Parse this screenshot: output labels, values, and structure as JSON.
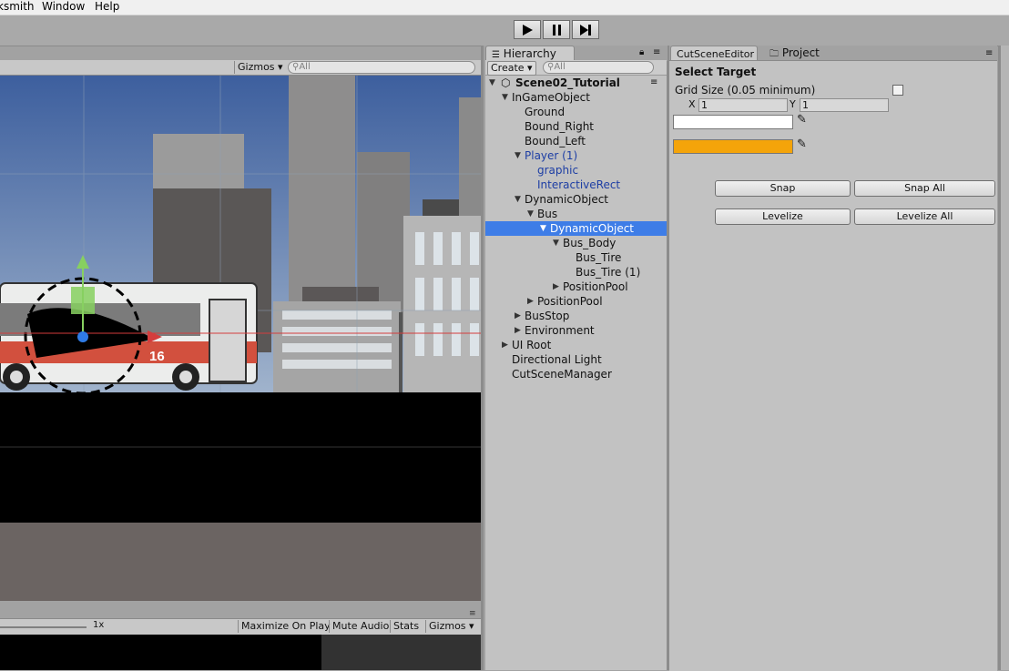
{
  "menu": {
    "items": [
      "ksmith",
      "Window",
      "Help"
    ]
  },
  "playbar": {
    "play_icon": "play-icon",
    "pause_icon": "pause-icon",
    "step_icon": "step-icon"
  },
  "scene": {
    "gizmos_label": "Gizmos",
    "search_placeholder": "All",
    "bus_number": "16"
  },
  "game": {
    "scale_label": "1x",
    "buttons": [
      "Maximize On Play",
      "Mute Audio",
      "Stats",
      "Gizmos"
    ]
  },
  "hierarchy": {
    "tab_label": "Hierarchy",
    "create_label": "Create",
    "search_placeholder": "All",
    "scene_name": "Scene02_Tutorial",
    "items": [
      {
        "label": "InGameObject",
        "arrow": "▼"
      },
      {
        "label": "Ground",
        "arrow": ""
      },
      {
        "label": "Bound_Right",
        "arrow": ""
      },
      {
        "label": "Bound_Left",
        "arrow": ""
      },
      {
        "label": "Player (1)",
        "arrow": "▼"
      },
      {
        "label": "graphic",
        "arrow": ""
      },
      {
        "label": "InteractiveRect",
        "arrow": ""
      },
      {
        "label": "DynamicObject",
        "arrow": "▼"
      },
      {
        "label": "Bus",
        "arrow": "▼"
      },
      {
        "label": "DynamicObject",
        "arrow": "▼"
      },
      {
        "label": "Bus_Body",
        "arrow": "▼"
      },
      {
        "label": "Bus_Tire",
        "arrow": ""
      },
      {
        "label": "Bus_Tire (1)",
        "arrow": ""
      },
      {
        "label": "PositionPool",
        "arrow": "▶"
      },
      {
        "label": "PositionPool",
        "arrow": "▶"
      },
      {
        "label": "BusStop",
        "arrow": "▶"
      },
      {
        "label": "Environment",
        "arrow": "▶"
      },
      {
        "label": "UI Root",
        "arrow": "▶"
      },
      {
        "label": "Directional Light",
        "arrow": ""
      },
      {
        "label": "CutSceneManager",
        "arrow": ""
      }
    ]
  },
  "cutscene": {
    "tab_label": "CutSceneEditor",
    "project_tab_label": "Project",
    "heading": "Select Target",
    "grid_size_label": "Grid Size (0.05 minimum)",
    "x_label": "X",
    "x_value": "1",
    "y_label": "Y",
    "y_value": "1",
    "color1": "#ffffff",
    "color2": "#f4a40a",
    "snap_label": "Snap",
    "snap_all_label": "Snap All",
    "levelize_label": "Levelize",
    "levelize_all_label": "Levelize All"
  }
}
